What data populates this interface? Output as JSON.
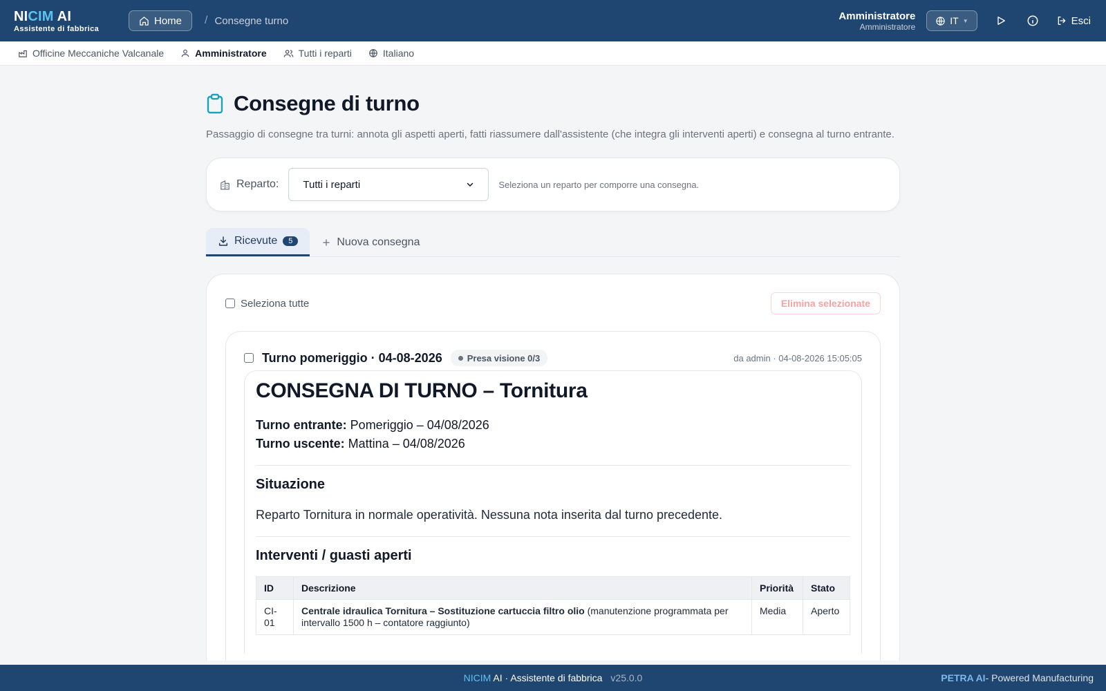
{
  "brand": {
    "name_prefix": "NI",
    "name_accent": "CIM",
    "name_suffix": " AI",
    "subtitle": "Assistente di fabbrica"
  },
  "topbar": {
    "home_label": "Home",
    "breadcrumb_sep": "/",
    "breadcrumb_current": "Consegne turno",
    "user_name": "Amministratore",
    "user_role": "Amministratore",
    "lang_label": "IT",
    "logout_label": "Esci"
  },
  "subbar": {
    "company": "Officine Meccaniche Valcanale",
    "user": "Amministratore",
    "department": "Tutti i reparti",
    "language": "Italiano"
  },
  "page": {
    "title": "Consegne di turno",
    "description": "Passaggio di consegne tra turni: annota gli aspetti aperti, fatti riassumere dall'assistente (che integra gli interventi aperti) e consegna al turno entrante."
  },
  "reparto": {
    "label": "Reparto:",
    "selected": "Tutti i reparti",
    "hint": "Seleziona un reparto per comporre una consegna."
  },
  "tabs": [
    {
      "label": "Ricevute",
      "badge": "5"
    },
    {
      "label": "Nuova consegna"
    }
  ],
  "list": {
    "select_all": "Seleziona tutte",
    "delete_label": "Elimina selezionate"
  },
  "handoff": {
    "title": "Turno pomeriggio · 04-08-2026",
    "status": "Presa visione 0/3",
    "meta": "da admin · 04-08-2026 15:05:05",
    "doc": {
      "heading": "CONSEGNA DI TURNO – Tornitura",
      "incoming_label": "Turno entrante:",
      "incoming_value": " Pomeriggio – 04/08/2026",
      "outgoing_label": "Turno uscente:",
      "outgoing_value": " Mattina – 04/08/2026",
      "situation_heading": "Situazione",
      "situation_text": "Reparto Tornitura in normale operatività. Nessuna nota inserita dal turno precedente.",
      "interventions_heading": "Interventi / guasti aperti",
      "table": {
        "headers": [
          "ID",
          "Descrizione",
          "Priorità",
          "Stato"
        ],
        "rows": [
          {
            "id": "CI-01",
            "desc_bold": "Centrale idraulica Tornitura – Sostituzione cartuccia filtro olio",
            "desc_rest": " (manutenzione programmata per intervallo 1500 h – contatore raggiunto)",
            "priority": "Media",
            "status": "Aperto"
          }
        ]
      }
    }
  },
  "footer": {
    "brand_accent": "NICIM",
    "brand_rest": " AI · Assistente di fabbrica",
    "version": "v25.0.0",
    "right_brand": "PETRA AI",
    "right_rest": " - Powered Manufacturing"
  },
  "colors": {
    "primary": "#1f4670",
    "accent": "#5ec2f0",
    "icon_teal": "#1aa3b8",
    "danger_light": "#f4a3a3"
  }
}
